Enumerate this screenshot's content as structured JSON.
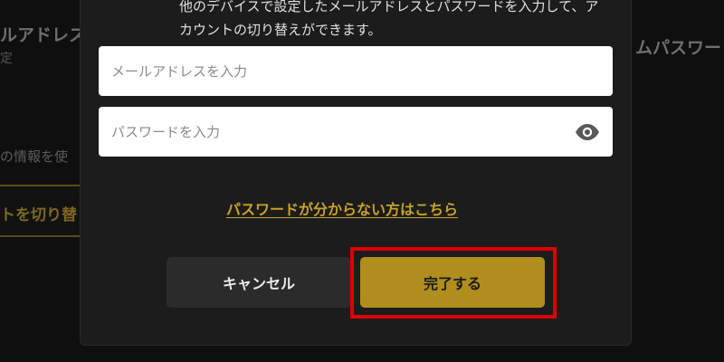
{
  "background": {
    "left_title": "ルアドレス",
    "left_sub": "定",
    "left_info": "の情報を使",
    "left_button_label": "トを切り替",
    "right_title": "ムパスワー"
  },
  "dialog": {
    "description": "他のデバイスで設定したメールアドレスとパスワードを入力して、アカウントの切り替えができます。",
    "email_placeholder": "メールアドレスを入力",
    "password_placeholder": "パスワードを入力",
    "password_toggle_icon": "eye-icon",
    "forgot_link": "パスワードが分からない方はこちら",
    "cancel_label": "キャンセル",
    "done_label": "完了する"
  },
  "colors": {
    "accent": "#b08d1d",
    "link": "#c9a227",
    "highlight": "#e00000",
    "dialog_bg": "#1c1c1c"
  }
}
